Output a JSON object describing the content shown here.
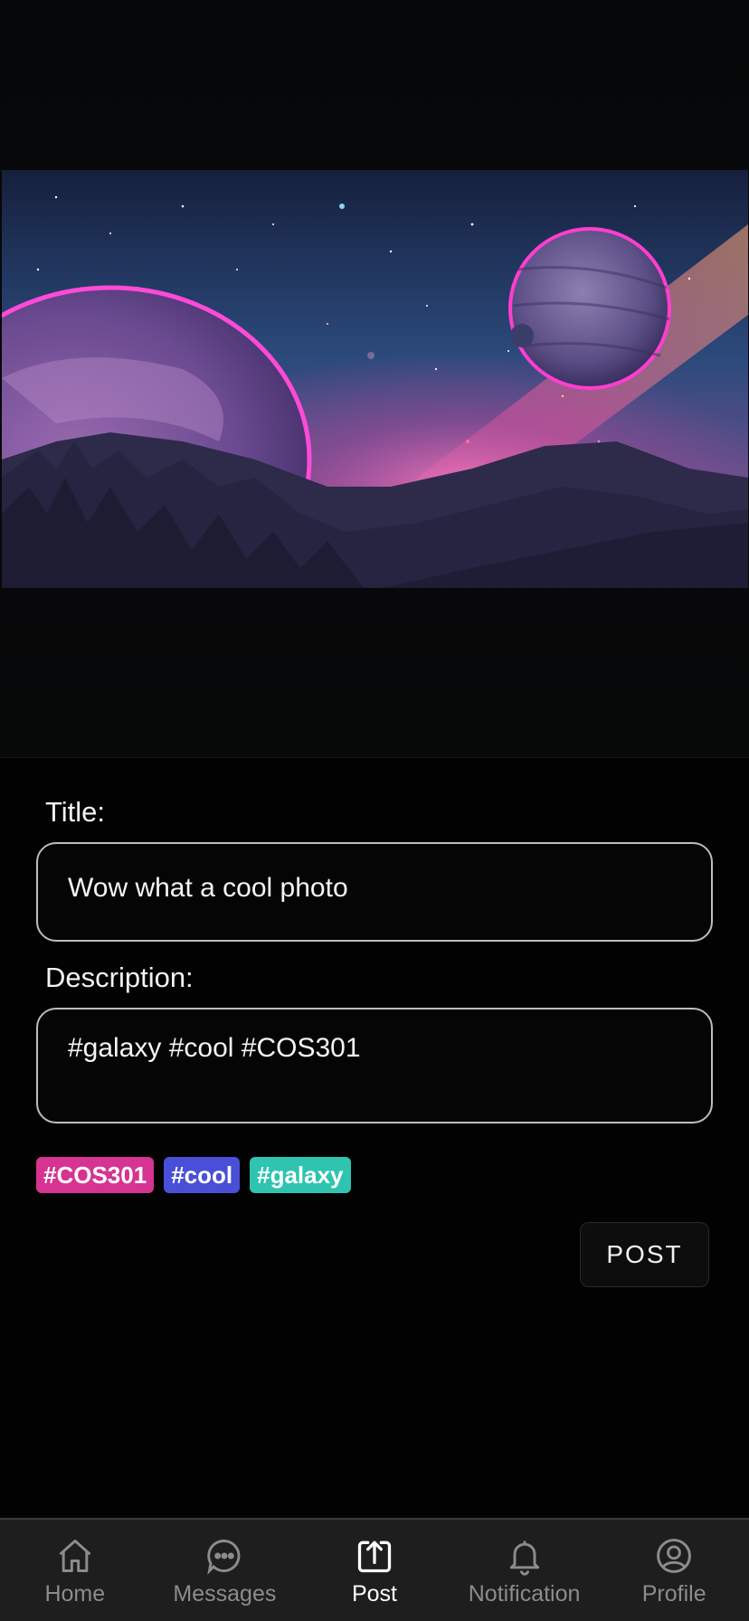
{
  "form": {
    "title_label": "Title:",
    "title_value": "Wow what a cool photo",
    "description_label": "Description:",
    "description_value": "#galaxy #cool #COS301"
  },
  "tags": [
    {
      "label": "#COS301",
      "color": "#d63392"
    },
    {
      "label": "#cool",
      "color": "#4a4fd8"
    },
    {
      "label": "#galaxy",
      "color": "#2ec4b0"
    }
  ],
  "post_button": "POST",
  "nav": {
    "active": "Post",
    "items": [
      {
        "label": "Home",
        "icon": "home-icon"
      },
      {
        "label": "Messages",
        "icon": "messages-icon"
      },
      {
        "label": "Post",
        "icon": "post-upload-icon"
      },
      {
        "label": "Notification",
        "icon": "bell-icon"
      },
      {
        "label": "Profile",
        "icon": "profile-icon"
      }
    ]
  }
}
